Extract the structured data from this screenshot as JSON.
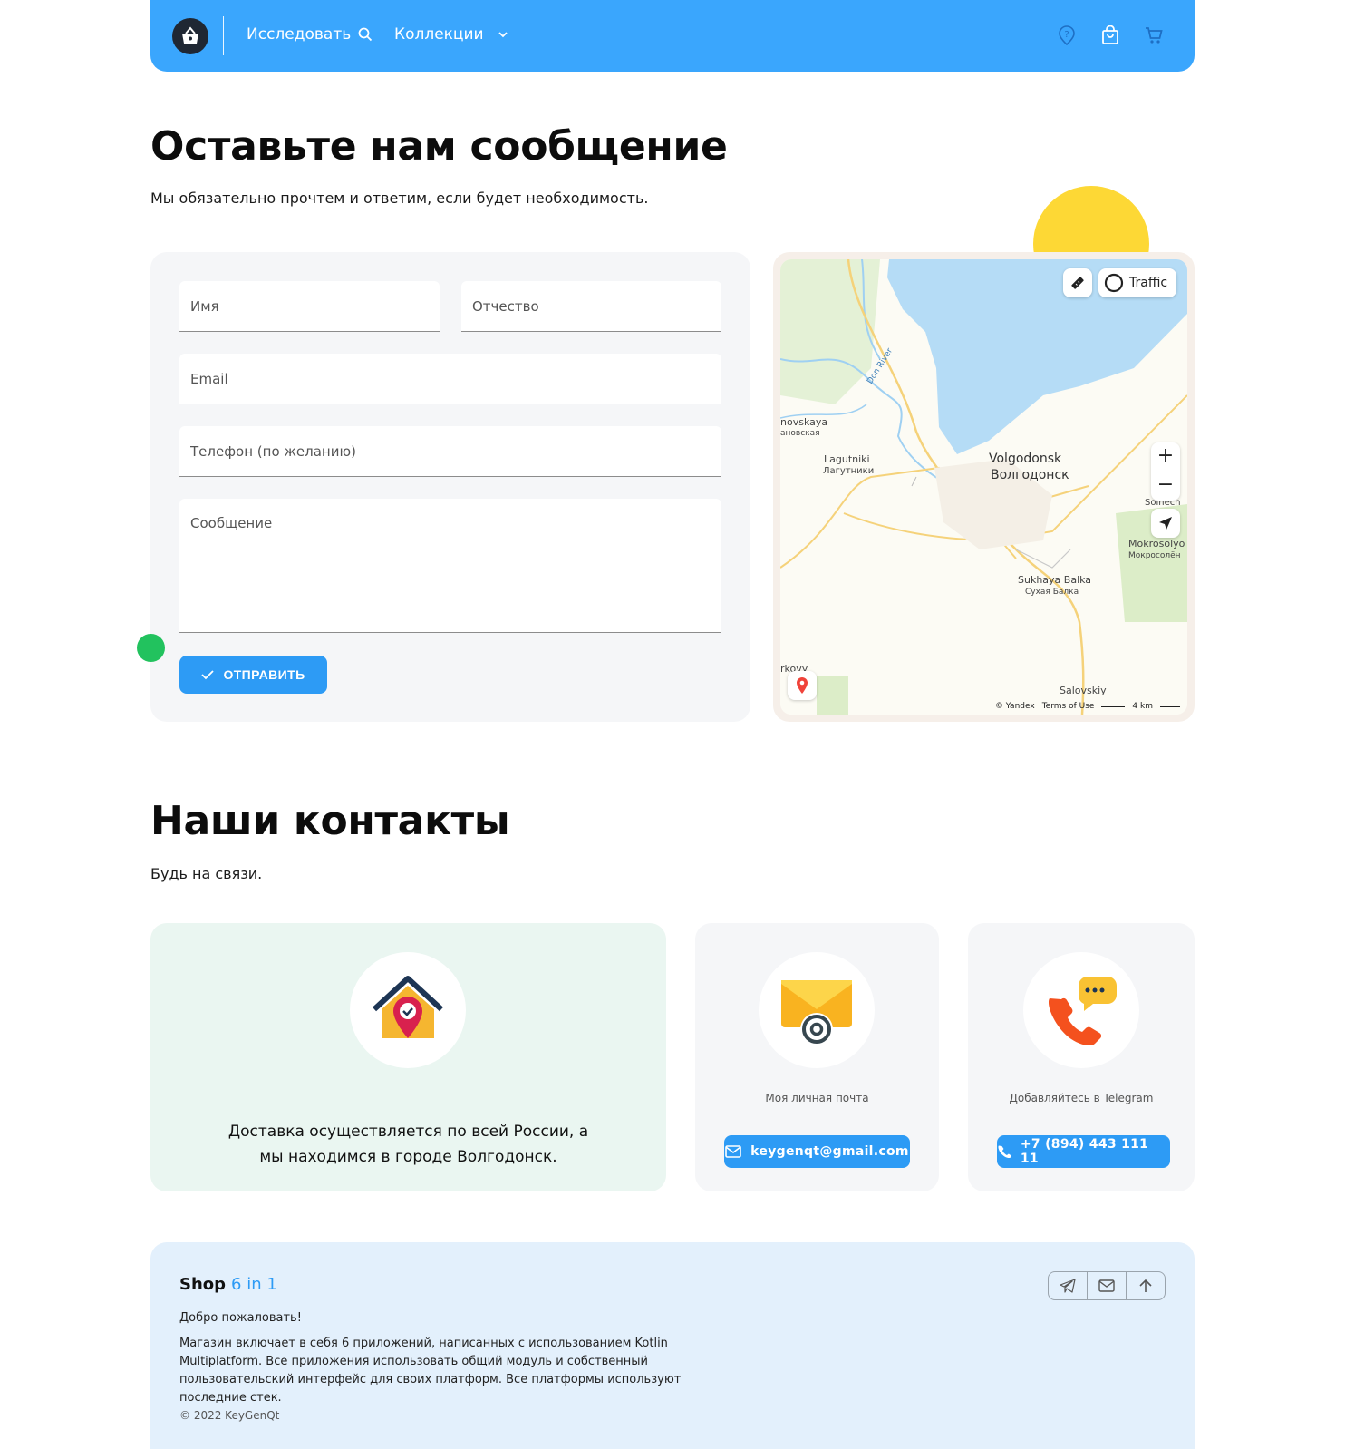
{
  "header": {
    "nav": [
      {
        "label": "Исследовать",
        "icon": "search-icon"
      },
      {
        "label": "Коллекции",
        "icon": "chevron-down-icon"
      }
    ],
    "icons": [
      "help-icon",
      "shopping-bag-icon",
      "cart-icon"
    ],
    "brand_color": "#3aa6fd"
  },
  "message_section": {
    "title": "Оставьте нам сообщение",
    "subtitle": "Мы обязательно прочтем и ответим, если будет необходимость.",
    "form": {
      "first_name_placeholder": "Имя",
      "patronymic_placeholder": "Отчество",
      "email_placeholder": "Email",
      "phone_placeholder": "Телефон (по желанию)",
      "message_placeholder": "Сообщение",
      "submit_label": "ОТПРАВИТЬ"
    }
  },
  "map": {
    "traffic_label": "Traffic",
    "labels": {
      "city_en": "Volgodonsk",
      "city_ru": "Волгодонск",
      "lagutniki_en": "Lagutniki",
      "lagutniki_ru": "Лагутники",
      "novskaya_en": "novskaya",
      "novskaya_ru": "ановская",
      "sukhaya_en": "Sukhaya Balka",
      "sukhaya_ru": "Сухая Балка",
      "mokrosol_en": "Mokrosolyo",
      "mokrosol_ru": "Мокросолён",
      "solnech": "Solnech",
      "salovskiy": "Salovskiy",
      "rkovy": "rkovy",
      "river": "Don River"
    },
    "zoom_in": "+",
    "zoom_out": "−",
    "attribution": "© Yandex",
    "terms": "Terms of Use",
    "scale": "4 km",
    "colors": {
      "water": "#b5dcf6",
      "land": "#fcfbf4",
      "road": "#f5d27a",
      "park": "#dcedc8"
    }
  },
  "contacts_section": {
    "title": "Наши контакты",
    "subtitle": "Будь на связи.",
    "cards": [
      {
        "icon": "house-location-icon",
        "text": "Доставка осуществляется по всей России, а мы находимся в городе Волгодонск."
      },
      {
        "icon": "envelope-at-icon",
        "caption": "Моя личная почта",
        "button_label": "keygenqt@gmail.com",
        "button_icon": "mail-icon"
      },
      {
        "icon": "phone-chat-icon",
        "caption": "Добавляйтесь в Telegram",
        "button_label": "+7 (894) 443 111 11",
        "button_icon": "phone-icon"
      }
    ]
  },
  "footer": {
    "brand": "Shop",
    "brand_accent": "6 in 1",
    "welcome": "Добро пожаловать!",
    "description": "Магазин включает в себя 6 приложений, написанных с использованием Kotlin Multiplatform. Все приложения использовать общий модуль и собственный пользовательский интерфейс для своих платформ. Все платформы используют последние стек.",
    "copyright": "© 2022 KeyGenQt",
    "buttons": [
      "telegram-icon",
      "mail-icon",
      "arrow-up-icon"
    ]
  }
}
